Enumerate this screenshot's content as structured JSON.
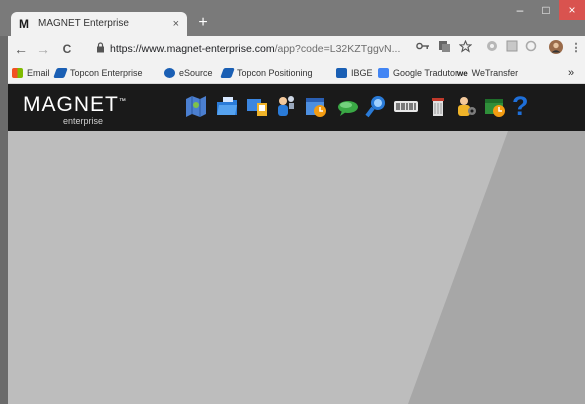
{
  "browser": {
    "tab_title": "MAGNET Enterprise",
    "tab_favicon": "M",
    "tab_close": "×",
    "new_tab": "+",
    "window_controls": {
      "minimize": "–",
      "maximize": "□",
      "close": "×"
    },
    "nav": {
      "back": "←",
      "forward": "→",
      "reload": "C"
    },
    "url_host": "https://www.magnet-enterprise.com",
    "url_rest": "/app?code=L32KZTggvN...",
    "bookmarks": [
      {
        "label": "Email",
        "icon": "ms-apps-icon",
        "color": "#f25022"
      },
      {
        "label": "Topcon Enterprise",
        "icon": "topcon-icon",
        "color": "#1a5fb4"
      },
      {
        "label": "eSource",
        "icon": "esource-icon",
        "color": "#1a5fb4"
      },
      {
        "label": "Topcon Positioning",
        "icon": "topcon-icon",
        "color": "#1a5fb4"
      },
      {
        "label": "IBGE",
        "icon": "ibge-icon",
        "color": "#1a5fb4"
      },
      {
        "label": "Google Tradutor",
        "icon": "translate-icon",
        "color": "#4285f4"
      },
      {
        "label": "WeTransfer",
        "icon": "wetransfer-icon",
        "color": "#222222"
      }
    ],
    "bookmarks_more": "»"
  },
  "app": {
    "logo_main": "MAGNET",
    "logo_tm": "™",
    "logo_sub": "enterprise",
    "help_label": "?",
    "toolbar_icons": [
      "map-icon",
      "folders-icon",
      "devices-icon",
      "users-icon",
      "calendar-icon",
      "chat-icon",
      "pin-search-icon",
      "barcode-scanner-icon",
      "trash-icon",
      "admin-user-icon",
      "schedule-icon",
      "help-icon"
    ]
  },
  "colors": {
    "header_bg": "#1a1a1a",
    "content_light": "#bdbdbd",
    "content_dark": "#a7a7a7",
    "accent_blue": "#1e6fd9"
  }
}
